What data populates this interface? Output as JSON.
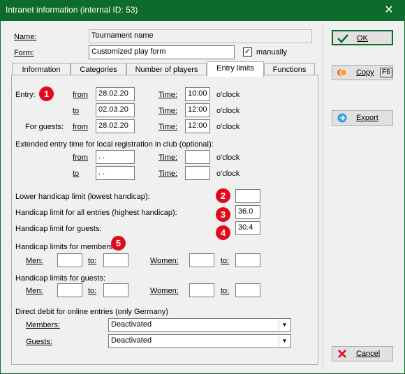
{
  "window": {
    "title": "Intranet information (internal ID: 53)",
    "close_glyph": "✕"
  },
  "header": {
    "name_label": "Name:",
    "name_value": "Tournament name",
    "form_label": "Form:",
    "form_value": "Customized play form",
    "manually_label": "manually",
    "manually_checked": true
  },
  "tabs": [
    {
      "label": "Information"
    },
    {
      "label": "Categories"
    },
    {
      "label": "Number of players"
    },
    {
      "label": "Entry limits",
      "active": true
    },
    {
      "label": "Functions"
    }
  ],
  "entry": {
    "label": "Entry:",
    "from_label": "from",
    "to_label": "to",
    "guests_label": "For guests:",
    "time_label": "Time:",
    "oclock": "o'clock",
    "from_date": "28.02.20",
    "from_time": "10:00",
    "to_date": "02.03.20",
    "to_time": "12:00",
    "guests_date": "28.02.20",
    "guests_time": "12:00"
  },
  "extended": {
    "label": "Extended entry time for local registration in club (optional):",
    "from_date": " .  .",
    "to_date": " .  .",
    "from_time": "",
    "to_time": ""
  },
  "handicap": {
    "lower_label": "Lower handicap limit (lowest handicap):",
    "lower_value": "",
    "all_label": "Handicap limit for all entries (highest handicap):",
    "all_value": "36.0",
    "guests_label": "Handicap limit for guests:",
    "guests_value": "30.4",
    "members_label": "Handicap limits for members:",
    "guests_group_label": "Handicap limits for guests:",
    "men_label": "Men:",
    "women_label": "Women:",
    "to_label": "to:",
    "members_men_from": "",
    "members_men_to": "",
    "members_women_from": "",
    "members_women_to": "",
    "guests_men_from": "",
    "guests_men_to": "",
    "guests_women_from": "",
    "guests_women_to": ""
  },
  "debit": {
    "label": "Direct debit for online entries (only Germany)",
    "members_label": "Members:",
    "members_value": "Deactivated",
    "guests_label": "Guests:",
    "guests_value": "Deactivated"
  },
  "badges": [
    "1",
    "2",
    "3",
    "4",
    "5"
  ],
  "buttons": {
    "ok": "OK",
    "copy": "Copy",
    "copy_key": "F6",
    "export": "Export",
    "cancel": "Cancel"
  },
  "colors": {
    "titlebar": "#0d6b2c",
    "badge": "#e3091d",
    "panel": "#f0f0f0"
  }
}
